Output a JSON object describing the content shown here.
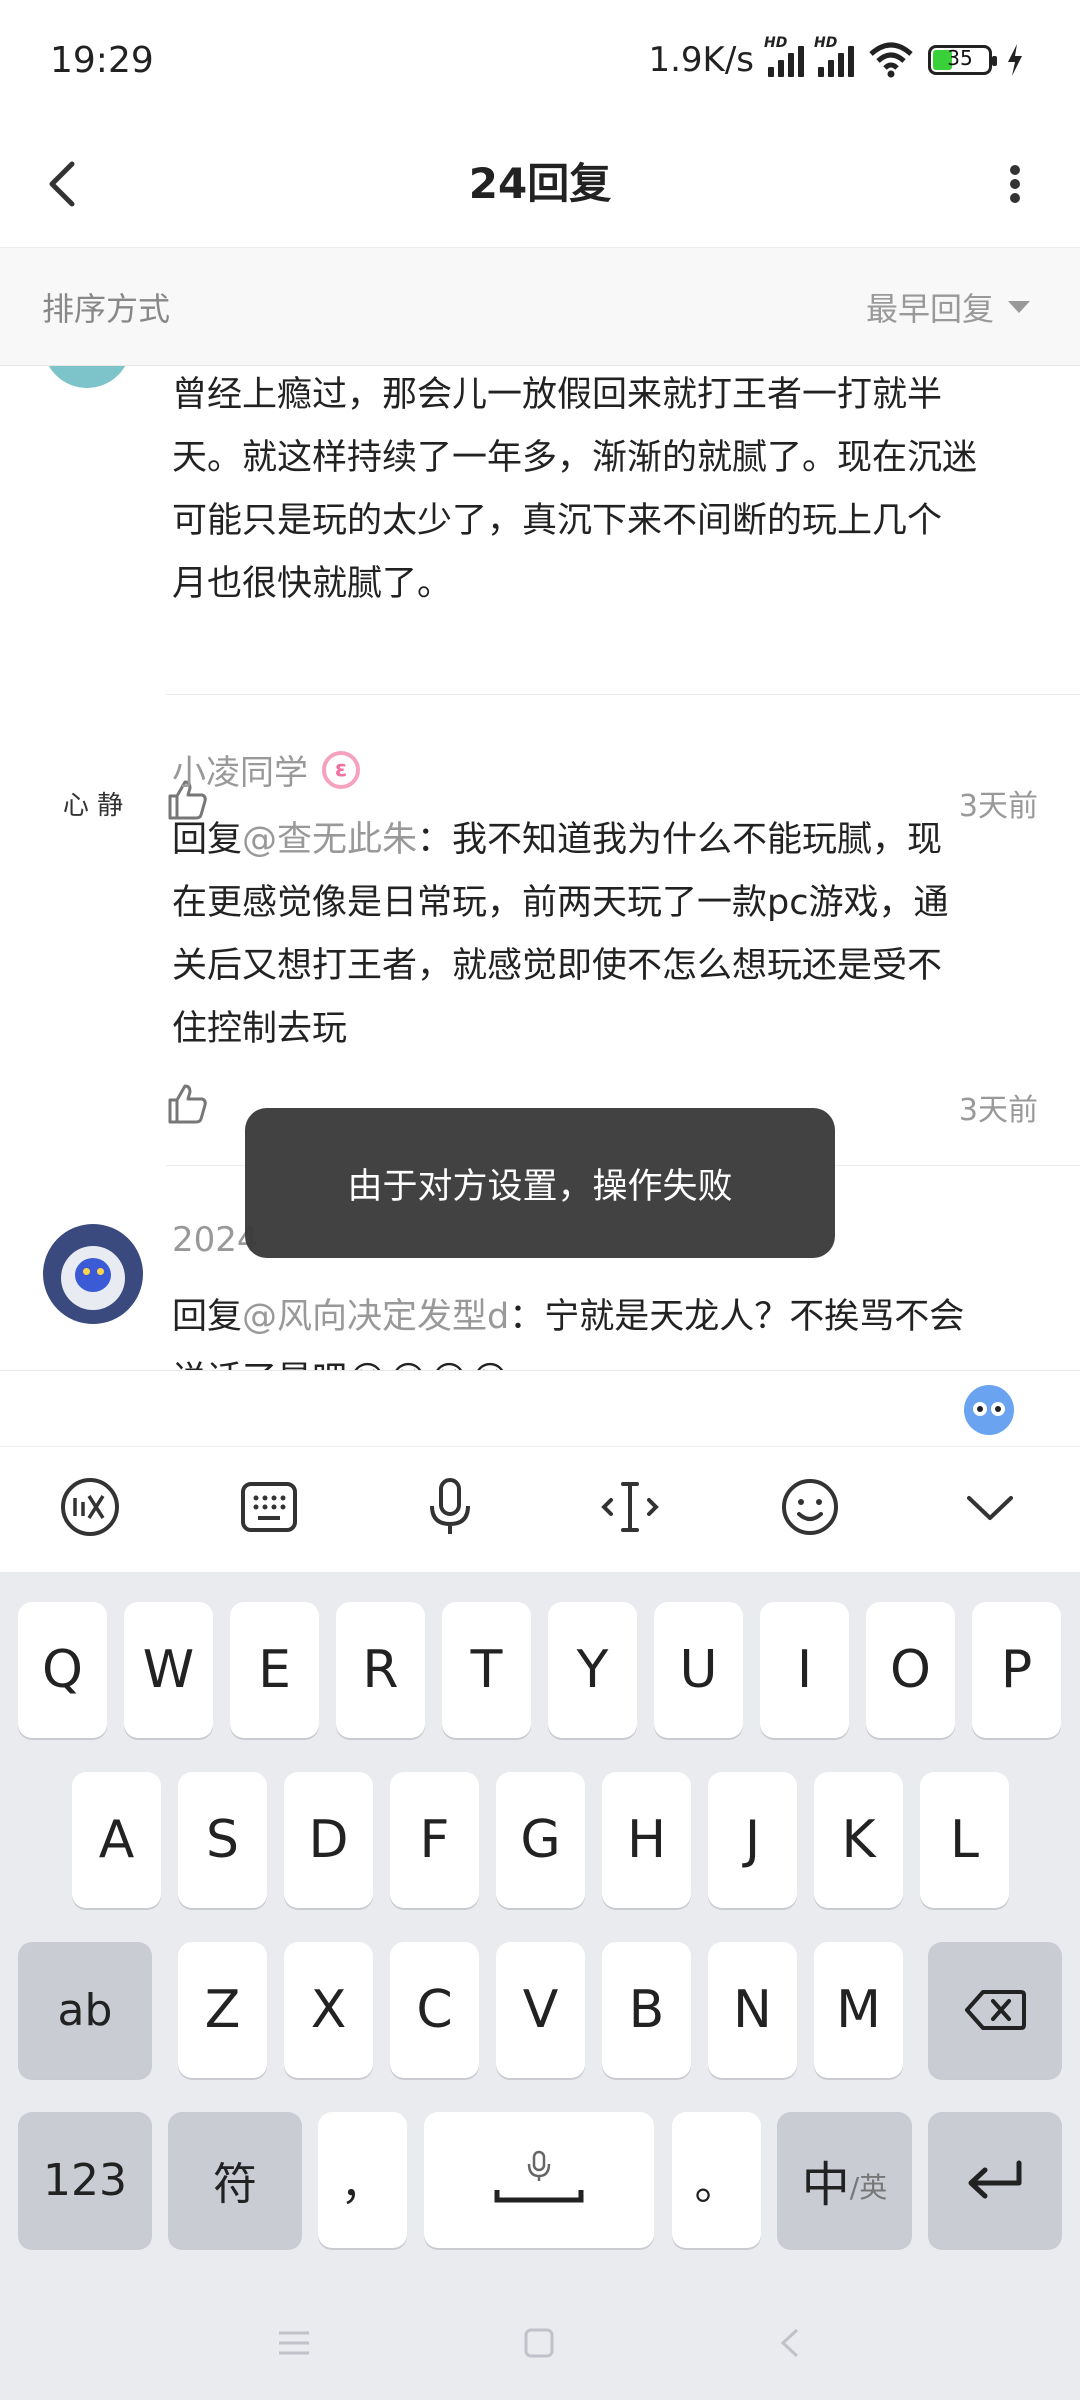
{
  "status": {
    "time": "19:29",
    "net_speed": "1.9K/s",
    "battery": "35"
  },
  "header": {
    "title": "24回复"
  },
  "sort": {
    "label": "排序方式",
    "value": "最早回复"
  },
  "comments": [
    {
      "lines": [
        "曾经上瘾过，那会儿一放假回来就打王者一打就半",
        "天。就这样持续了一年多，渐渐的就腻了。现在沉迷",
        "可能只是玩的太少了，真沉下来不间断的玩上几个",
        "月也很快就腻了。"
      ],
      "time": "3天前"
    },
    {
      "avatar_text": "心 静",
      "username": "小凌同学",
      "badge": "ε",
      "reply_prefix": "回复",
      "mention": "@查无此朱",
      "lines_first": "：我不知道我为什么不能玩腻，现",
      "lines": [
        "在更感觉像是日常玩，前两天玩了一款pc游戏，通",
        "关后又想打王者，就感觉即使不怎么想玩还是受不",
        "住控制去玩"
      ],
      "time": "3天前"
    },
    {
      "username": "2024",
      "reply_prefix": "回复",
      "mention": "@风向决定发型d",
      "lines_first": "：宁就是天龙人？不挨骂不会",
      "lines": [
        "说话了是吧😭😭😭😭"
      ]
    }
  ],
  "toast": {
    "text": "由于对方设置，操作失败"
  },
  "keyboard": {
    "row1": [
      "Q",
      "W",
      "E",
      "R",
      "T",
      "Y",
      "U",
      "I",
      "O",
      "P"
    ],
    "row2": [
      "A",
      "S",
      "D",
      "F",
      "G",
      "H",
      "J",
      "K",
      "L"
    ],
    "row3": [
      "Z",
      "X",
      "C",
      "V",
      "B",
      "N",
      "M"
    ],
    "shift_label": "ab",
    "num_label": "123",
    "symbol_label": "符",
    "comma": "，",
    "period": "。",
    "lang_main": "中",
    "lang_sub": "/英"
  }
}
